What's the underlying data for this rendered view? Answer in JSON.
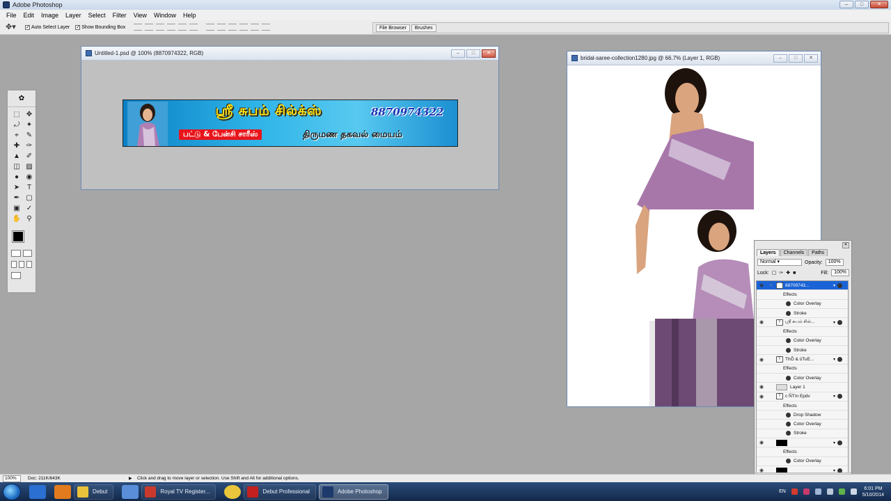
{
  "app": {
    "title": "Adobe Photoshop"
  },
  "menu": [
    "File",
    "Edit",
    "Image",
    "Layer",
    "Select",
    "Filter",
    "View",
    "Window",
    "Help"
  ],
  "options": {
    "auto_select_layer": "Auto Select Layer",
    "show_bounding_box": "Show Bounding Box",
    "well_tabs": [
      "File Browser",
      "Brushes"
    ]
  },
  "doc1": {
    "title": "Untitled-1.psd @ 100% (8870974322, RGB)",
    "banner": {
      "brand": "ஸ்ரீ சுபம் சில்க்ஸ்",
      "phone": "8870974322",
      "sub1": "பட்டு & பேன்சி சாரீஸ்",
      "sub2": "திருமண தகவல் மையம்"
    }
  },
  "doc2": {
    "title": "bridal-saree-collection1280.jpg @ 66.7% (Layer 1, RGB)"
  },
  "layers_panel": {
    "tabs": [
      "Layers",
      "Channels",
      "Paths"
    ],
    "blend_mode": "Normal",
    "opacity_label": "Opacity:",
    "opacity_value": "100%",
    "lock_label": "Lock:",
    "fill_label": "Fill:",
    "fill_value": "100%",
    "rows": [
      {
        "kind": "text",
        "name": "88709743...",
        "selected": true
      },
      {
        "kind": "effects",
        "name": "Effects"
      },
      {
        "kind": "effect",
        "name": "Color Overlay"
      },
      {
        "kind": "effect",
        "name": "Stroke"
      },
      {
        "kind": "text",
        "name": "ஸ்ரீ சுபம் சில்..."
      },
      {
        "kind": "effects",
        "name": "Effects"
      },
      {
        "kind": "effect",
        "name": "Color Overlay"
      },
      {
        "kind": "effect",
        "name": "Stroke"
      },
      {
        "kind": "text",
        "name": "ThÕ & üTuE..."
      },
      {
        "kind": "effects",
        "name": "Effects"
      },
      {
        "kind": "effect",
        "name": "Color Overlay"
      },
      {
        "kind": "layer",
        "name": "Layer 1"
      },
      {
        "kind": "text",
        "name": "c ÑTm Epdv"
      },
      {
        "kind": "effects",
        "name": "Effects"
      },
      {
        "kind": "effect",
        "name": "Drop Shadow"
      },
      {
        "kind": "effect",
        "name": "Color Overlay"
      },
      {
        "kind": "effect",
        "name": "Stroke"
      },
      {
        "kind": "shape",
        "name": ""
      },
      {
        "kind": "effects",
        "name": "Effects"
      },
      {
        "kind": "effect",
        "name": "Color Overlay"
      },
      {
        "kind": "shape",
        "name": ""
      }
    ]
  },
  "status": {
    "zoom": "100%",
    "doc": "Doc: 211K/643K",
    "hint": "Click and drag to move layer or selection.  Use Shift and Alt for additional options."
  },
  "taskbar": {
    "tasks": [
      {
        "label": "Debut",
        "active": false
      },
      {
        "label": "Royal TV Register...",
        "active": false
      },
      {
        "label": "Debut Professional",
        "active": false
      },
      {
        "label": "Adobe Photoshop",
        "active": true
      }
    ],
    "lang": "EN",
    "time": "6:01 PM",
    "date": "5/10/2014"
  }
}
